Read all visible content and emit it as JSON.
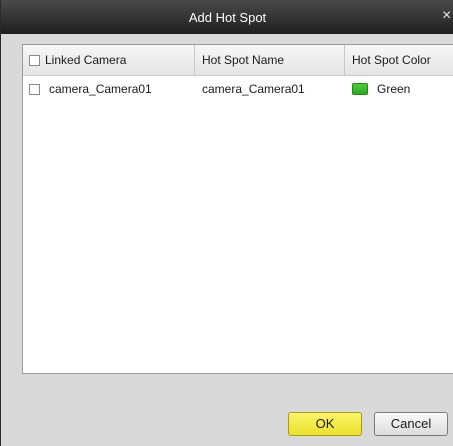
{
  "dialog": {
    "title": "Add Hot Spot"
  },
  "table": {
    "columns": [
      "Linked Camera",
      "Hot Spot Name",
      "Hot Spot Color"
    ],
    "rows": [
      {
        "linked_camera": "camera_Camera01",
        "hot_spot_name": "camera_Camera01",
        "hot_spot_color": "Green",
        "color_hex": "#3cbf2c",
        "checked": false
      }
    ],
    "select_all_checked": false
  },
  "buttons": {
    "ok": "OK",
    "cancel": "Cancel"
  },
  "colors": {
    "ok_button": "#f2e838",
    "titlebar": "#2e2e2e"
  }
}
